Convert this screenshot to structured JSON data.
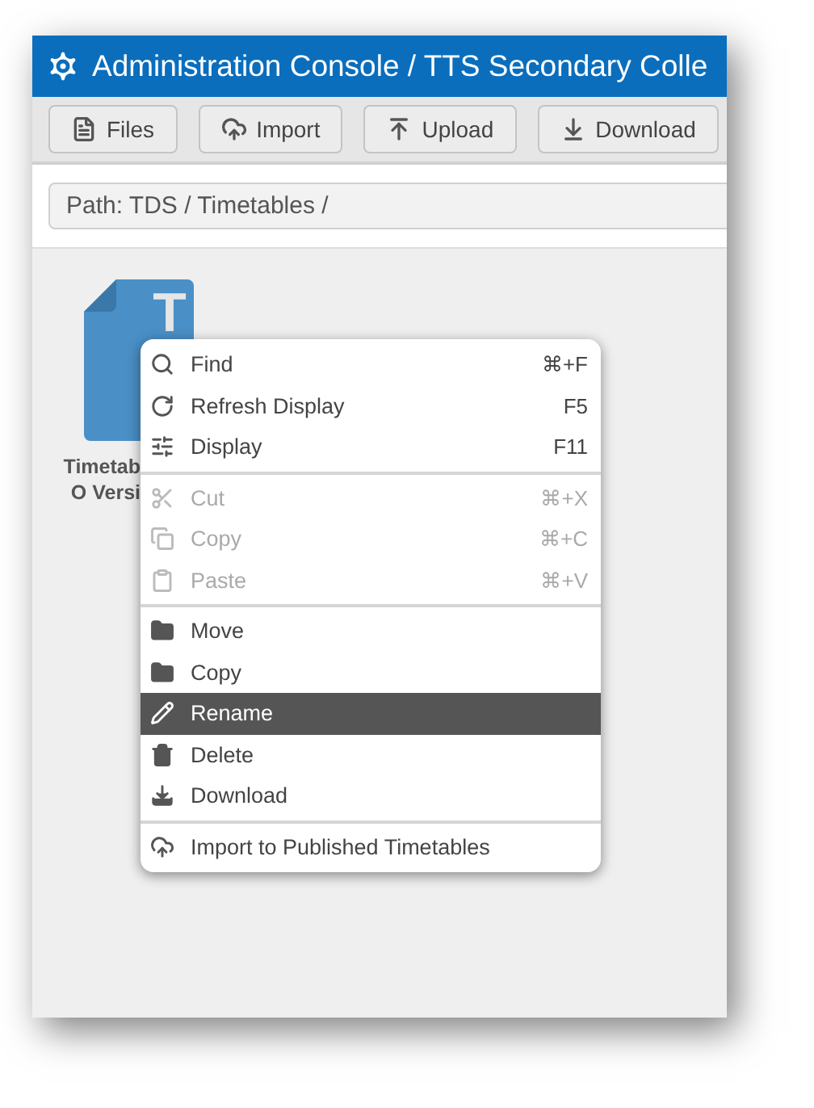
{
  "window": {
    "title": "Administration Console / TTS Secondary Colle"
  },
  "toolbar": {
    "buttons": [
      {
        "label": "Files"
      },
      {
        "label": "Import"
      },
      {
        "label": "Upload"
      },
      {
        "label": "Download"
      }
    ]
  },
  "path": {
    "text": "Path: TDS / Timetables /"
  },
  "files": [
    {
      "label_lines": [
        "Timetab",
        "O Versi"
      ],
      "letter": "T"
    }
  ],
  "context_menu": {
    "sections": [
      [
        {
          "label": "Find",
          "shortcut": "⌘+F",
          "disabled": false,
          "selected": false
        },
        {
          "label": "Refresh Display",
          "shortcut": "F5",
          "disabled": false,
          "selected": false
        },
        {
          "label": "Display",
          "shortcut": "F11",
          "disabled": false,
          "selected": false
        }
      ],
      [
        {
          "label": "Cut",
          "shortcut": "⌘+X",
          "disabled": true,
          "selected": false
        },
        {
          "label": "Copy",
          "shortcut": "⌘+C",
          "disabled": true,
          "selected": false
        },
        {
          "label": "Paste",
          "shortcut": "⌘+V",
          "disabled": true,
          "selected": false
        }
      ],
      [
        {
          "label": "Move",
          "disabled": false,
          "selected": false
        },
        {
          "label": "Copy",
          "disabled": false,
          "selected": false
        },
        {
          "label": "Rename",
          "disabled": false,
          "selected": true
        },
        {
          "label": "Delete",
          "disabled": false,
          "selected": false
        },
        {
          "label": "Download",
          "disabled": false,
          "selected": false
        }
      ],
      [
        {
          "label": "Import to Published Timetables",
          "disabled": false,
          "selected": false
        }
      ]
    ]
  }
}
